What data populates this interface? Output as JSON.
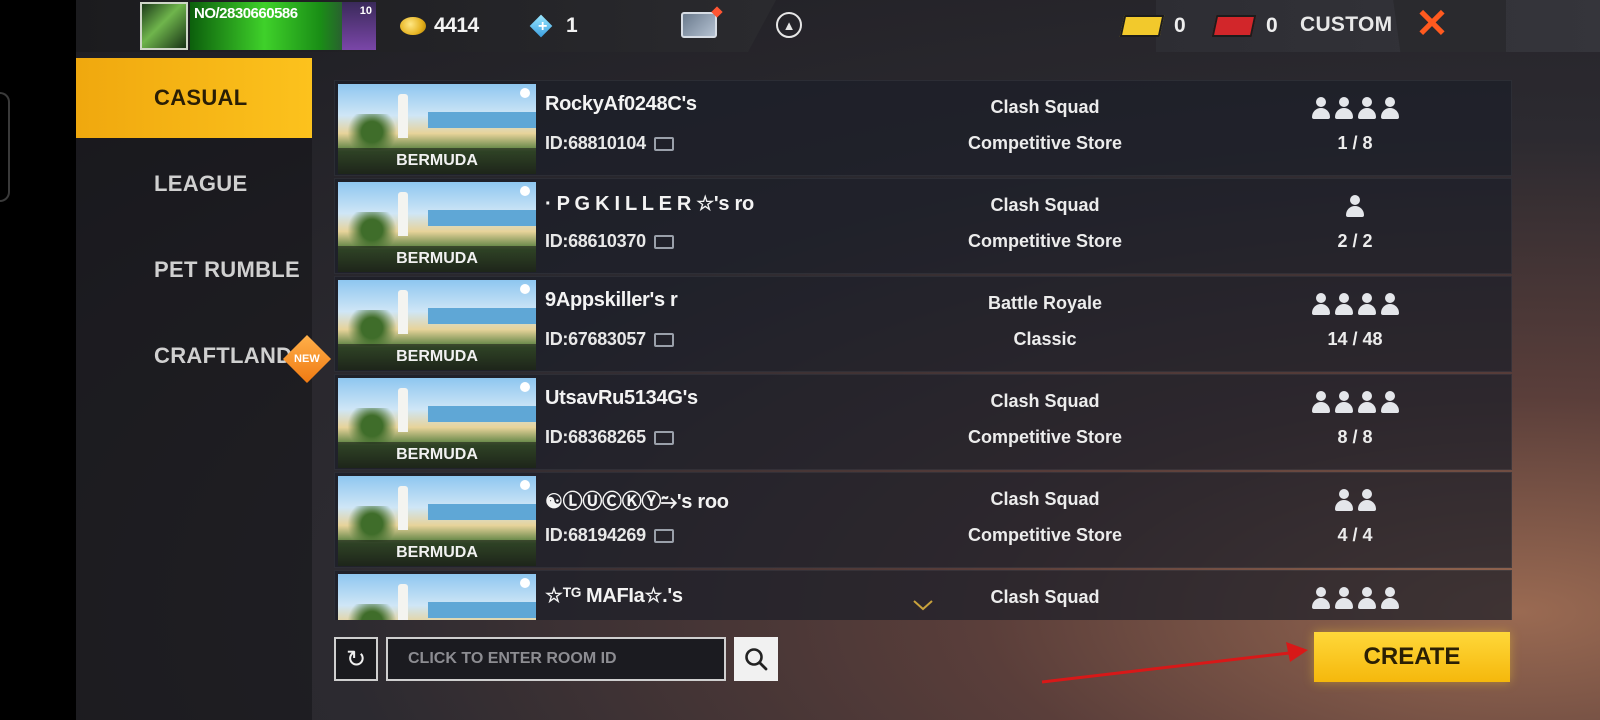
{
  "topbar": {
    "player_id": "NO/2830660586",
    "level_tag": "10",
    "coins": "4414",
    "diamonds": "1",
    "ticket_yellow": "0",
    "ticket_red": "0",
    "mode_label": "CUSTOM",
    "close_glyph": "✕"
  },
  "sidebar": {
    "tabs": [
      {
        "label": "CASUAL",
        "active": true
      },
      {
        "label": "LEAGUE",
        "active": false
      },
      {
        "label": "PET RUMBLE",
        "active": false
      },
      {
        "label": "CRAFTLAND",
        "active": false
      }
    ],
    "new_badge": "NEW"
  },
  "rooms": [
    {
      "name": "RockyAf0248C's",
      "id": "ID:68810104",
      "map": "BERMUDA",
      "mode": "Clash Squad",
      "sub": "Competitive Store",
      "icons": 4,
      "count": "1 / 8"
    },
    {
      "name": "· P G K I L L E R ☆'s ro",
      "id": "ID:68610370",
      "map": "BERMUDA",
      "mode": "Clash Squad",
      "sub": "Competitive Store",
      "icons": 1,
      "count": "2 / 2"
    },
    {
      "name": "9Appskiller's r",
      "id": "ID:67683057",
      "map": "BERMUDA",
      "mode": "Battle Royale",
      "sub": "Classic",
      "icons": 4,
      "count": "14 / 48"
    },
    {
      "name": "UtsavRu5134G's",
      "id": "ID:68368265",
      "map": "BERMUDA",
      "mode": "Clash Squad",
      "sub": "Competitive Store",
      "icons": 4,
      "count": "8 / 8"
    },
    {
      "name": "☯ⓁⓊⒸⓀⓎ⥲'s roo",
      "id": "ID:68194269",
      "map": "BERMUDA",
      "mode": "Clash Squad",
      "sub": "Competitive Store",
      "icons": 2,
      "count": "4 / 4"
    },
    {
      "name": "☆ᵀᴳ MAFIa☆.'s",
      "id": "",
      "map": "",
      "mode": "Clash Squad",
      "sub": "",
      "icons": 4,
      "count": ""
    }
  ],
  "search": {
    "placeholder": "CLICK TO ENTER ROOM ID",
    "value": ""
  },
  "buttons": {
    "refresh_glyph": "↻",
    "create_label": "CREATE"
  },
  "colors": {
    "accent": "#fcc21d",
    "close": "#ff5a1f",
    "arrow": "#d81818"
  }
}
